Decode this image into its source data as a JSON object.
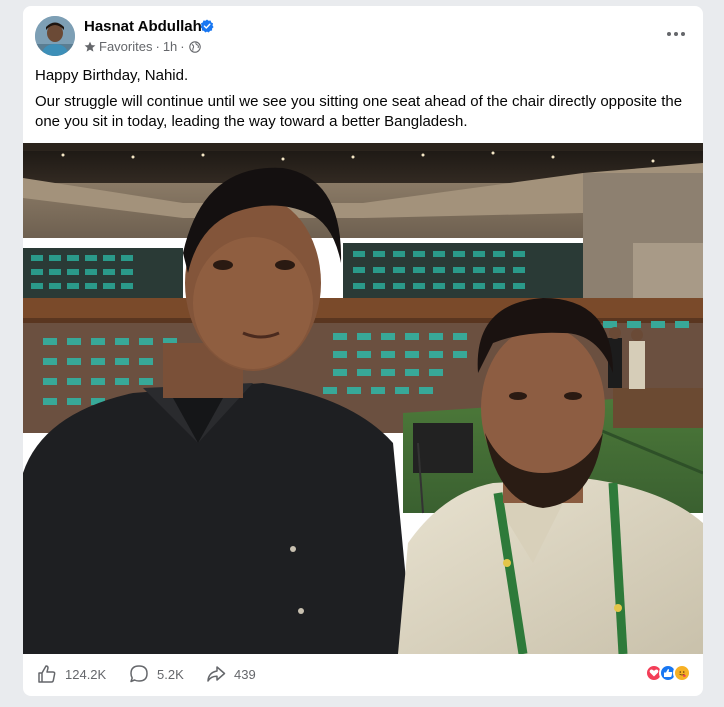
{
  "post": {
    "author": "Hasnat Abdullah",
    "audience": "Favorites",
    "time": "1h",
    "separator": "·",
    "text": [
      "Happy Birthday, Nahid.",
      "Our struggle will continue until we see you sitting one seat ahead of the chair directly opposite the one you sit in today, leading the way toward a better Bangladesh."
    ]
  },
  "footer": {
    "likes": "124.2K",
    "comments": "5.2K",
    "shares": "439"
  },
  "icons": {
    "verified": "verified-badge-icon",
    "audience": "star-icon",
    "privacy": "globe-icon",
    "more": "more-options-icon",
    "like": "thumbs-up-icon",
    "comment": "comment-bubble-icon",
    "share": "share-arrow-icon"
  },
  "colors": {
    "verified": "#1877f2",
    "love": "#f33e58",
    "like": "#1877f2",
    "care": "#f7b125",
    "muted": "#65676b"
  }
}
